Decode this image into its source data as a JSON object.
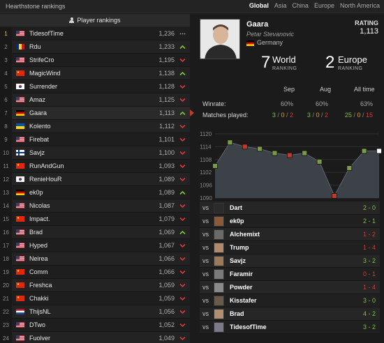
{
  "app": {
    "title": "Hearthstone rankings"
  },
  "regions": [
    {
      "label": "Global",
      "active": true
    },
    {
      "label": "Asia",
      "active": false
    },
    {
      "label": "China",
      "active": false
    },
    {
      "label": "Europe",
      "active": false
    },
    {
      "label": "North America",
      "active": false
    }
  ],
  "left_header": "Player rankings",
  "players": [
    {
      "rank": "1",
      "name": "TidesofTime",
      "rating": "1,236",
      "trend": "same",
      "flag": "us"
    },
    {
      "rank": "2",
      "name": "Rdu",
      "rating": "1,233",
      "trend": "up",
      "flag": "ro"
    },
    {
      "rank": "3",
      "name": "StrifeCro",
      "rating": "1,195",
      "trend": "down",
      "flag": "us"
    },
    {
      "rank": "4",
      "name": "MagicWind",
      "rating": "1,138",
      "trend": "up",
      "flag": "cn"
    },
    {
      "rank": "5",
      "name": "Surrender",
      "rating": "1,128",
      "trend": "down",
      "flag": "kr"
    },
    {
      "rank": "6",
      "name": "Amaz",
      "rating": "1,125",
      "trend": "down",
      "flag": "us"
    },
    {
      "rank": "7",
      "name": "Gaara",
      "rating": "1,113",
      "trend": "up",
      "flag": "de",
      "selected": true
    },
    {
      "rank": "8",
      "name": "Kolento",
      "rating": "1,112",
      "trend": "down",
      "flag": "ua"
    },
    {
      "rank": "9",
      "name": "Firebat",
      "rating": "1,101",
      "trend": "down",
      "flag": "us"
    },
    {
      "rank": "10",
      "name": "Savjz",
      "rating": "1,100",
      "trend": "down",
      "flag": "fi"
    },
    {
      "rank": "11",
      "name": "RunAndGun",
      "rating": "1,093",
      "trend": "down",
      "flag": "cn"
    },
    {
      "rank": "12",
      "name": "RenieHouR",
      "rating": "1,089",
      "trend": "down",
      "flag": "kr"
    },
    {
      "rank": "13",
      "name": "ek0p",
      "rating": "1,089",
      "trend": "up",
      "flag": "de"
    },
    {
      "rank": "14",
      "name": "Nicolas",
      "rating": "1,087",
      "trend": "down",
      "flag": "us"
    },
    {
      "rank": "15",
      "name": "Impact.",
      "rating": "1,079",
      "trend": "down",
      "flag": "cn"
    },
    {
      "rank": "16",
      "name": "Brad",
      "rating": "1,069",
      "trend": "up",
      "flag": "us"
    },
    {
      "rank": "17",
      "name": "Hyped",
      "rating": "1,067",
      "trend": "down",
      "flag": "us"
    },
    {
      "rank": "18",
      "name": "Neirea",
      "rating": "1,066",
      "trend": "down",
      "flag": "us"
    },
    {
      "rank": "19",
      "name": "Comm",
      "rating": "1,066",
      "trend": "down",
      "flag": "cn"
    },
    {
      "rank": "20",
      "name": "Freshca",
      "rating": "1,059",
      "trend": "down",
      "flag": "cn"
    },
    {
      "rank": "21",
      "name": "Chakki",
      "rating": "1,059",
      "trend": "down",
      "flag": "cn"
    },
    {
      "rank": "22",
      "name": "ThijsNL",
      "rating": "1,056",
      "trend": "down",
      "flag": "nl"
    },
    {
      "rank": "23",
      "name": "DTwo",
      "rating": "1,052",
      "trend": "down",
      "flag": "us"
    },
    {
      "rank": "24",
      "name": "Fuolver",
      "rating": "1,049",
      "trend": "down",
      "flag": "us"
    }
  ],
  "profile": {
    "name": "Gaara",
    "real_name": "Petar Stevanovic",
    "country": "Germany",
    "rating_label": "RATING",
    "rating_value": "1,113",
    "world_rank": "7",
    "world_label": "World",
    "europe_rank": "2",
    "europe_label": "Europe",
    "ranking_word": "RANKING"
  },
  "stats": {
    "columns": [
      "Sep",
      "Aug",
      "All time"
    ],
    "winrate_label": "Winrate:",
    "winrate": [
      "60%",
      "60%",
      "63%"
    ],
    "matches_label": "Matches played:",
    "matches": [
      {
        "w": "3",
        "d": "0",
        "l": "2"
      },
      {
        "w": "3",
        "d": "0",
        "l": "2"
      },
      {
        "w": "25",
        "d": "0",
        "l": "15"
      }
    ]
  },
  "chart_data": {
    "type": "area",
    "y_ticks": [
      "1120",
      "1114",
      "1108",
      "1102",
      "1096",
      "1090"
    ],
    "ylim": [
      1090,
      1120
    ],
    "values": [
      1105,
      1116,
      1114,
      1113,
      1111,
      1110,
      1111,
      1107,
      1091,
      1104,
      1112,
      1112
    ],
    "grid": true
  },
  "vs_label": "vs",
  "opponents": [
    {
      "name": "Dart",
      "score": "2 - 0",
      "result": "win",
      "avatar_color": "#2b2b2b"
    },
    {
      "name": "ek0p",
      "score": "2 - 1",
      "result": "win",
      "avatar_color": "#8a5a3a"
    },
    {
      "name": "Alchemixt",
      "score": "1 - 2",
      "result": "loss",
      "avatar_color": "#6a6a6a"
    },
    {
      "name": "Trump",
      "score": "1 - 4",
      "result": "loss",
      "avatar_color": "#b08a6a"
    },
    {
      "name": "Savjz",
      "score": "3 - 2",
      "result": "win",
      "avatar_color": "#9a7a5a"
    },
    {
      "name": "Faramir",
      "score": "0 - 1",
      "result": "loss",
      "avatar_color": "#7a7a7a"
    },
    {
      "name": "Powder",
      "score": "1 - 4",
      "result": "loss",
      "avatar_color": "#8a8a8a"
    },
    {
      "name": "Kisstafer",
      "score": "3 - 0",
      "result": "win",
      "avatar_color": "#6a5a4a"
    },
    {
      "name": "Brad",
      "score": "4 - 2",
      "result": "win",
      "avatar_color": "#b09070"
    },
    {
      "name": "TidesofTime",
      "score": "3 - 2",
      "result": "win",
      "avatar_color": "#7a7a8a"
    }
  ]
}
